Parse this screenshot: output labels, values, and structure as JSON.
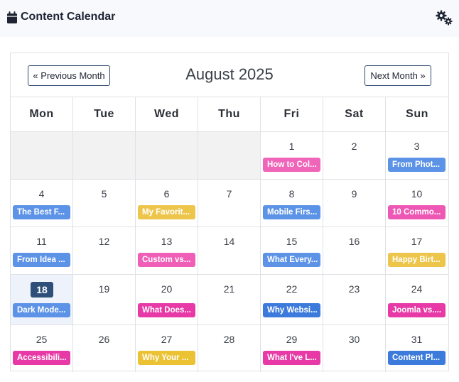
{
  "header": {
    "title": "Content Calendar",
    "icon": "calendar-icon",
    "settings_icon": "cogs-icon"
  },
  "calendar": {
    "prev_label": "« Previous Month",
    "next_label": "Next Month »",
    "month_label": "August 2025",
    "weekdays": [
      "Mon",
      "Tue",
      "Wed",
      "Thu",
      "Fri",
      "Sat",
      "Sun"
    ],
    "colors": {
      "blue": "#5b8fe3",
      "pink": "#ef5fb8",
      "yellow": "#eec54b",
      "magenta": "#e73aa6",
      "blue_dark": "#3c7bdc"
    },
    "weeks": [
      [
        {
          "empty": true
        },
        {
          "empty": true
        },
        {
          "empty": true
        },
        {
          "empty": true
        },
        {
          "day": "1",
          "event": "How to Col...",
          "color": "#f065b9"
        },
        {
          "day": "2"
        },
        {
          "day": "3",
          "event": "From Phot...",
          "color": "#5d93e6"
        }
      ],
      [
        {
          "day": "4",
          "event": "The Best F...",
          "color": "#5d93e6"
        },
        {
          "day": "5"
        },
        {
          "day": "6",
          "event": "My Favorit...",
          "color": "#eec54b"
        },
        {
          "day": "7"
        },
        {
          "day": "8",
          "event": "Mobile Firs...",
          "color": "#5d93e6"
        },
        {
          "day": "9"
        },
        {
          "day": "10",
          "event": "10 Commo...",
          "color": "#ee58b5"
        }
      ],
      [
        {
          "day": "11",
          "event": "From Idea ...",
          "color": "#5d93e6"
        },
        {
          "day": "12"
        },
        {
          "day": "13",
          "event": "Custom vs...",
          "color": "#ef5fb8"
        },
        {
          "day": "14"
        },
        {
          "day": "15",
          "event": "What Every...",
          "color": "#5d93e6"
        },
        {
          "day": "16"
        },
        {
          "day": "17",
          "event": "Happy Birt...",
          "color": "#eec54b"
        }
      ],
      [
        {
          "day": "18",
          "event": "Dark Mode...",
          "color": "#5d93e6",
          "today": true
        },
        {
          "day": "19"
        },
        {
          "day": "20",
          "event": "What Does...",
          "color": "#e73aa6"
        },
        {
          "day": "21"
        },
        {
          "day": "22",
          "event": "Why Websi...",
          "color": "#3c7bdc"
        },
        {
          "day": "23"
        },
        {
          "day": "24",
          "event": "Joomla vs....",
          "color": "#e73aa6"
        }
      ],
      [
        {
          "day": "25",
          "event": "Accessibili...",
          "color": "#e73aa6"
        },
        {
          "day": "26"
        },
        {
          "day": "27",
          "event": "Why Your ...",
          "color": "#ecc235"
        },
        {
          "day": "28"
        },
        {
          "day": "29",
          "event": "What I've L...",
          "color": "#e73aa6"
        },
        {
          "day": "30"
        },
        {
          "day": "31",
          "event": "Content Pl...",
          "color": "#3c7bdc"
        }
      ]
    ]
  }
}
